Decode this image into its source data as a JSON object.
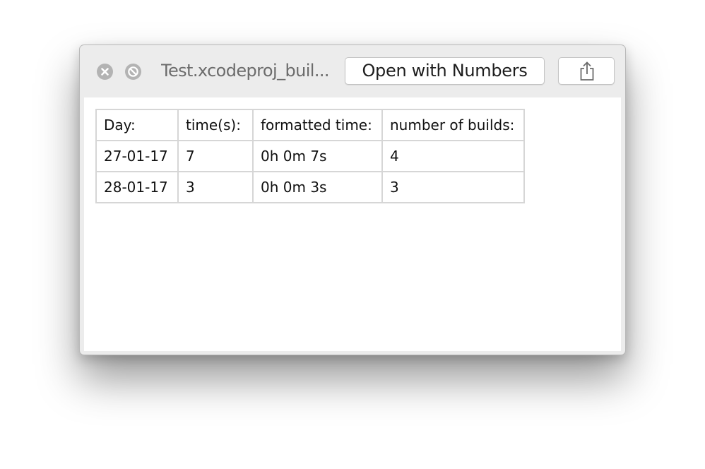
{
  "window": {
    "title": "Test.xcodeproj_buil...",
    "open_button_label": "Open with Numbers",
    "close_icon": "close-icon",
    "fullscreen_icon": "fullscreen-icon",
    "share_icon": "share-icon"
  },
  "table": {
    "headers": [
      "Day:",
      "time(s):",
      "formatted time:",
      "number of builds:"
    ],
    "rows": [
      [
        "27-01-17",
        "7",
        "0h 0m 7s",
        "4"
      ],
      [
        "28-01-17",
        "3",
        "0h 0m 3s",
        "3"
      ]
    ]
  }
}
